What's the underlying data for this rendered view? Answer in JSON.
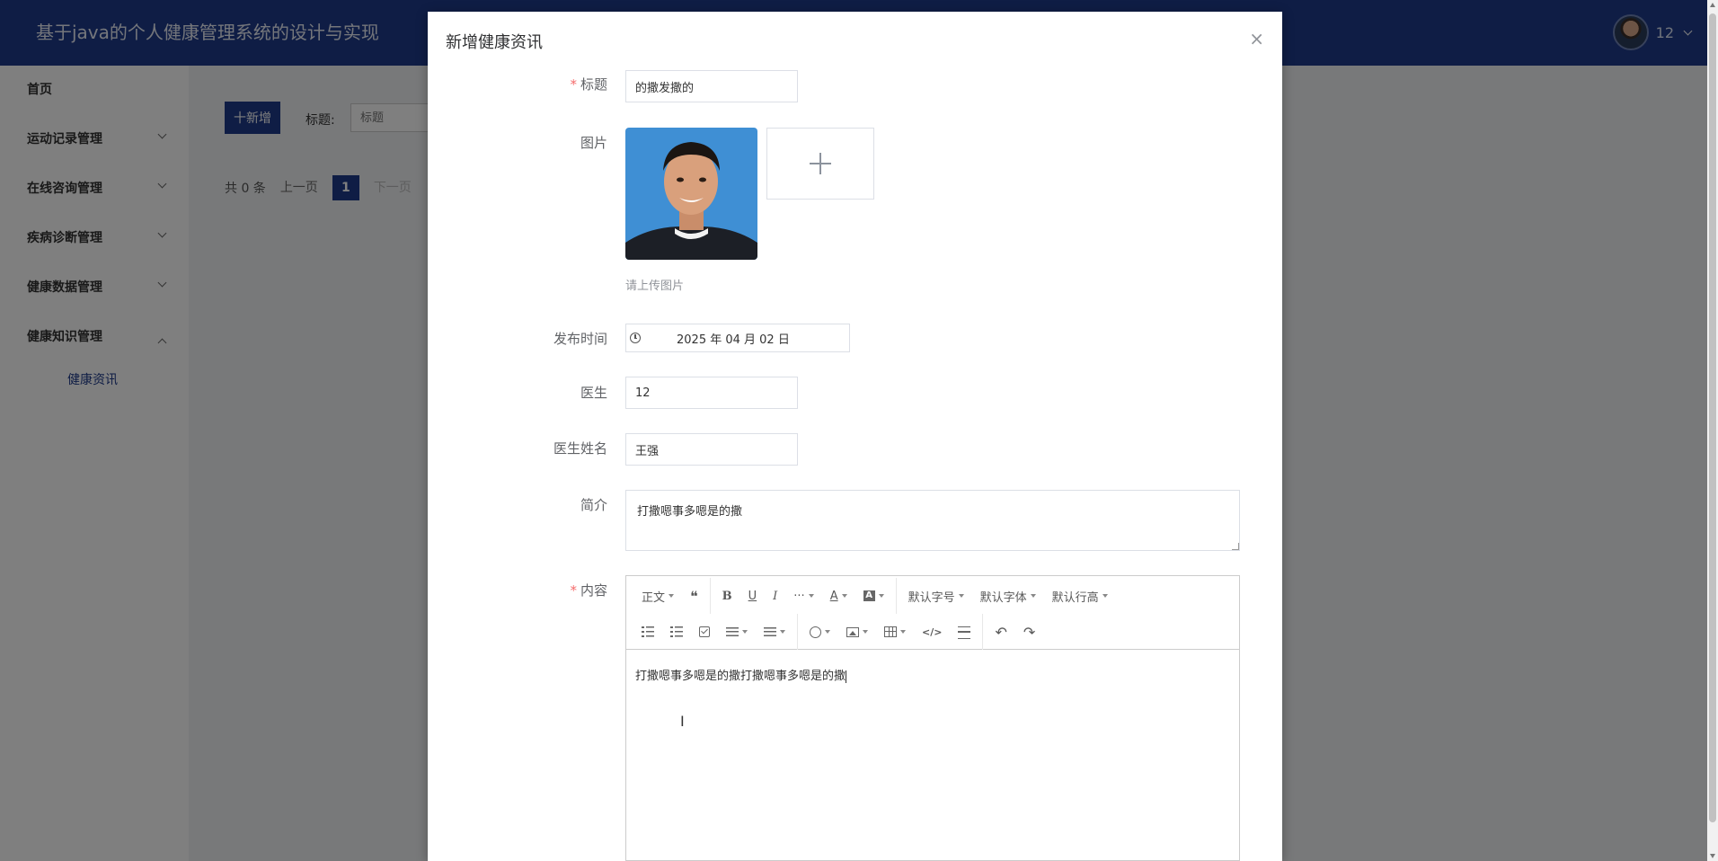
{
  "header": {
    "title": "基于java的个人健康管理系统的设计与实现",
    "username": "12"
  },
  "sidebar": {
    "items": [
      {
        "label": "首页"
      },
      {
        "label": "运动记录管理"
      },
      {
        "label": "在线咨询管理"
      },
      {
        "label": "疾病诊断管理"
      },
      {
        "label": "健康数据管理"
      },
      {
        "label": "健康知识管理"
      }
    ],
    "subitems": [
      {
        "label": "健康资讯"
      }
    ]
  },
  "main": {
    "add_label": "十新增",
    "filter_label": "标题:",
    "filter_placeholder": "标题",
    "pager": {
      "total": "共 0 条",
      "prev": "上一页",
      "current": "1",
      "next": "下一页"
    }
  },
  "dialog": {
    "title": "新增健康资讯",
    "close": "×",
    "fields": {
      "title": {
        "label": "标题",
        "value": "的撒发撒的"
      },
      "image": {
        "label": "图片",
        "tip": "请上传图片"
      },
      "publish_time": {
        "label": "发布时间",
        "value": "2025 年 04 月 02 日"
      },
      "doctor": {
        "label": "医生",
        "value": "12"
      },
      "doctor_name": {
        "label": "医生姓名",
        "value": "王强"
      },
      "summary": {
        "label": "简介",
        "value": "打撒嗯事多嗯是的撒"
      },
      "content": {
        "label": "内容",
        "value": "打撒嗯事多嗯是的撒打撒嗯事多嗯是的撒"
      }
    },
    "required_mark": "*"
  },
  "editor_toolbar": {
    "paragraph": "正文",
    "font_size": "默认字号",
    "font_family": "默认字体",
    "line_height": "默认行高",
    "more": "···",
    "font_color": "A",
    "bg_color": "A",
    "bold": "B",
    "underline": "U",
    "italic": "I",
    "quote": "❝",
    "code": "</>",
    "undo": "↶",
    "redo": "↷"
  },
  "colors": {
    "header_bg": "#1e3a8a",
    "accent": "#1e3a8a",
    "required": "#f56c6c"
  }
}
